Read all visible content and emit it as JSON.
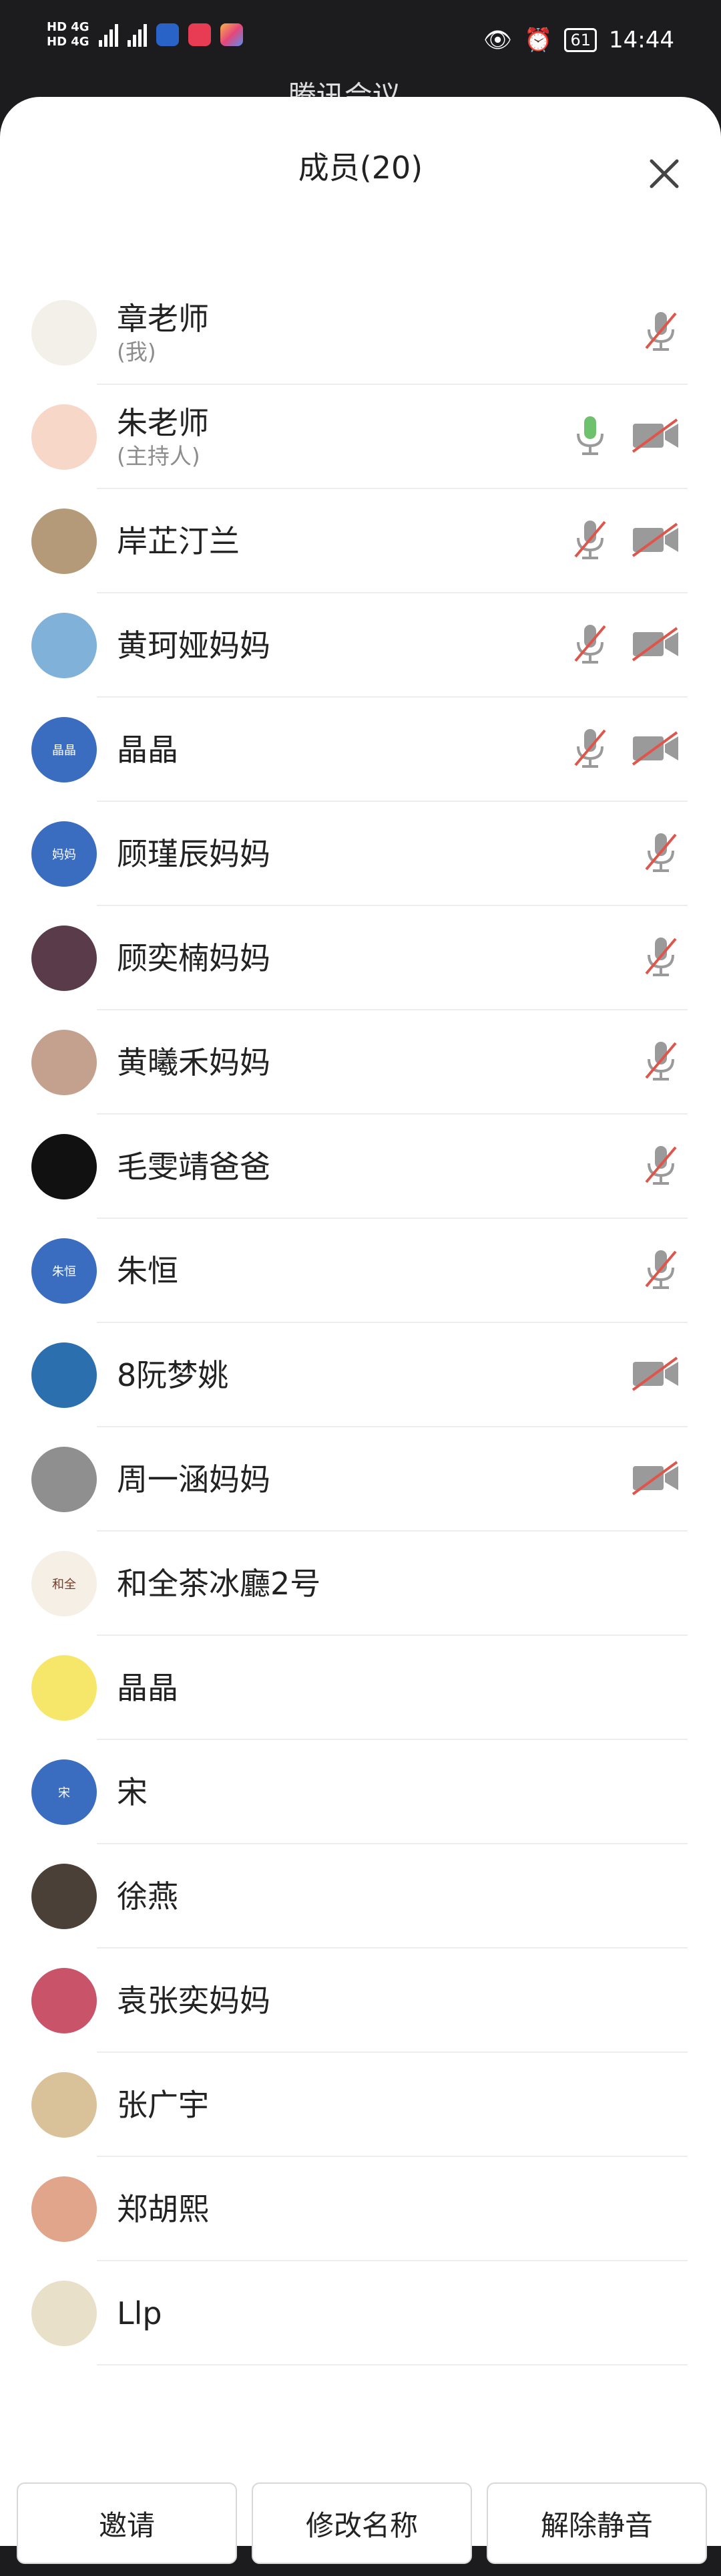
{
  "status_bar": {
    "left_a": "HD 4G",
    "left_b": "HD 4G",
    "battery": "61",
    "time": "14:44"
  },
  "background_title": "腾讯会议 ⌄",
  "panel": {
    "title": "成员(20)",
    "close_icon": "close-icon"
  },
  "members": [
    {
      "name": "章老师",
      "sub": "(我)",
      "avatar_text": "",
      "avatar_color": "#f3efe9",
      "mic": "muted",
      "cam": "none"
    },
    {
      "name": "朱老师",
      "sub": "(主持人)",
      "avatar_text": "",
      "avatar_color": "#f6d7c8",
      "mic": "on",
      "cam": "off"
    },
    {
      "name": "岸芷汀兰",
      "sub": "",
      "avatar_text": "",
      "avatar_color": "#b59a7a",
      "mic": "muted",
      "cam": "off"
    },
    {
      "name": "黄珂娅妈妈",
      "sub": "",
      "avatar_text": "",
      "avatar_color": "#7fb1d9",
      "mic": "muted",
      "cam": "off"
    },
    {
      "name": "晶晶",
      "sub": "",
      "avatar_text": "晶晶",
      "avatar_color": "#3a6cc0",
      "mic": "muted",
      "cam": "off"
    },
    {
      "name": "顾瑾辰妈妈",
      "sub": "",
      "avatar_text": "妈妈",
      "avatar_color": "#3a6cc0",
      "mic": "muted",
      "cam": "none"
    },
    {
      "name": "顾奕楠妈妈",
      "sub": "",
      "avatar_text": "",
      "avatar_color": "#5a3b4a",
      "mic": "muted",
      "cam": "none"
    },
    {
      "name": "黄曦禾妈妈",
      "sub": "",
      "avatar_text": "",
      "avatar_color": "#c4a08e",
      "mic": "muted",
      "cam": "none"
    },
    {
      "name": "毛雯靖爸爸",
      "sub": "",
      "avatar_text": "",
      "avatar_color": "#111111",
      "mic": "muted",
      "cam": "none"
    },
    {
      "name": "朱恒",
      "sub": "",
      "avatar_text": "朱恒",
      "avatar_color": "#3a6cc0",
      "mic": "muted",
      "cam": "none"
    },
    {
      "name": "8阮梦姚",
      "sub": "",
      "avatar_text": "",
      "avatar_color": "#2b6fae",
      "mic": "none",
      "cam": "off"
    },
    {
      "name": "周一涵妈妈",
      "sub": "",
      "avatar_text": "",
      "avatar_color": "#8f8f8f",
      "mic": "none",
      "cam": "off"
    },
    {
      "name": "和全茶冰廳2号",
      "sub": "",
      "avatar_text": "和全",
      "avatar_color": "#f5efe6",
      "mic": "none",
      "cam": "none"
    },
    {
      "name": "晶晶",
      "sub": "",
      "avatar_text": "",
      "avatar_color": "#f6e76a",
      "mic": "none",
      "cam": "none"
    },
    {
      "name": "宋",
      "sub": "",
      "avatar_text": "宋",
      "avatar_color": "#3a6cc0",
      "mic": "none",
      "cam": "none"
    },
    {
      "name": "徐燕",
      "sub": "",
      "avatar_text": "",
      "avatar_color": "#4a4038",
      "mic": "none",
      "cam": "none"
    },
    {
      "name": "袁张奕妈妈",
      "sub": "",
      "avatar_text": "",
      "avatar_color": "#c9546a",
      "mic": "none",
      "cam": "none"
    },
    {
      "name": "张广宇",
      "sub": "",
      "avatar_text": "",
      "avatar_color": "#d9c29a",
      "mic": "none",
      "cam": "none"
    },
    {
      "name": "郑胡熙",
      "sub": "",
      "avatar_text": "",
      "avatar_color": "#e0a58a",
      "mic": "none",
      "cam": "none"
    },
    {
      "name": "Llp",
      "sub": "",
      "avatar_text": "",
      "avatar_color": "#e8e0c8",
      "mic": "none",
      "cam": "none"
    }
  ],
  "buttons": {
    "invite": "邀请",
    "rename": "修改名称",
    "unmute": "解除静音"
  },
  "colors": {
    "muted_red": "#e0554a",
    "icon_gray": "#9a9a9a",
    "mic_on_green": "#6ec26e"
  }
}
